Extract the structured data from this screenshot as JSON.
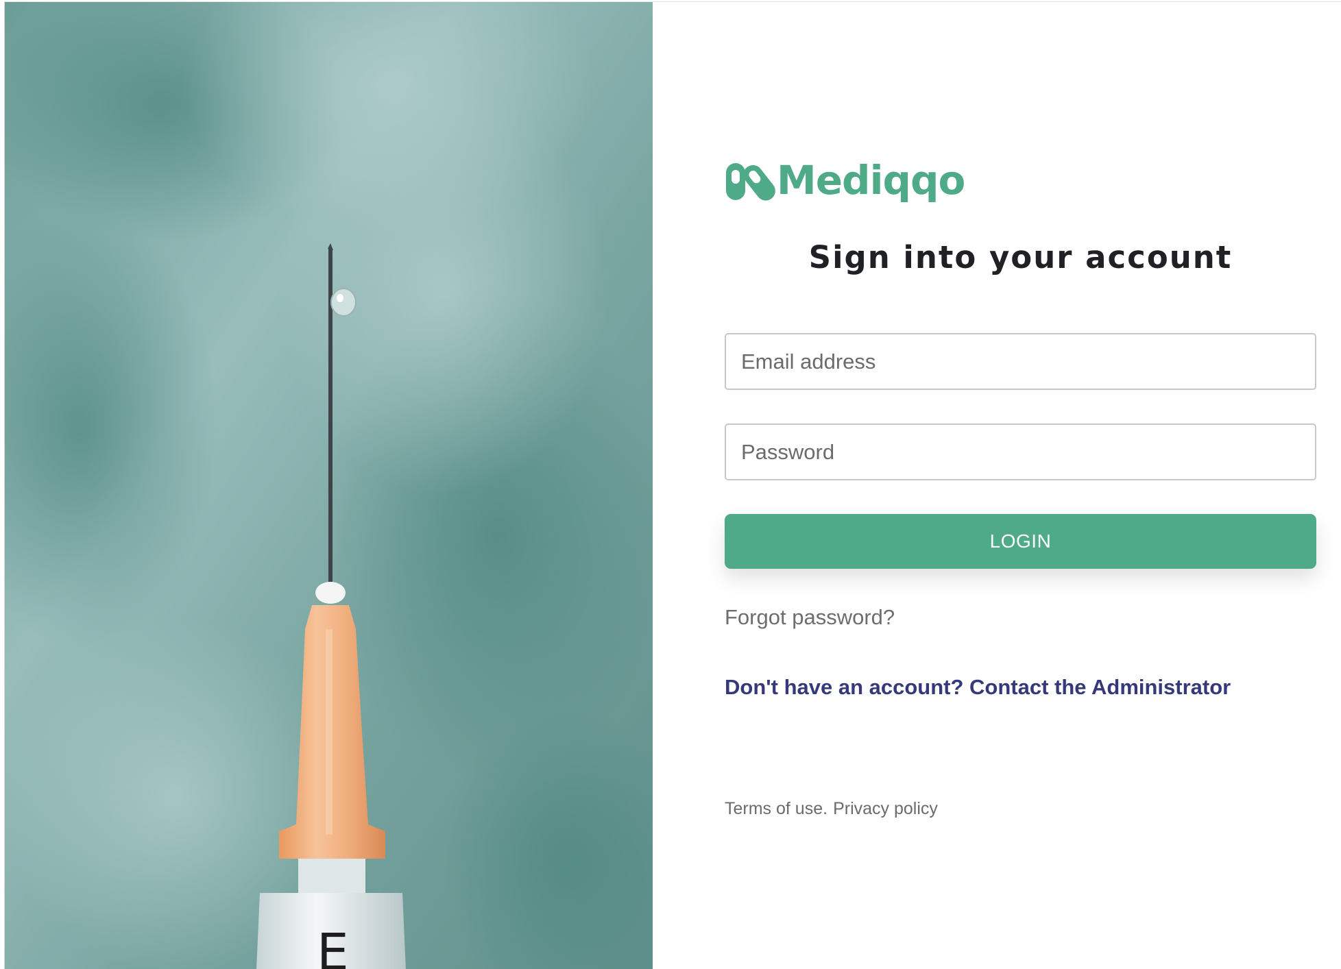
{
  "brand": {
    "name": "Mediqqo",
    "color": "#4faa87"
  },
  "hero": {
    "subject": "syringe-needle-photo",
    "background_color": "#7fa9a6",
    "syringe_marking": "E"
  },
  "form": {
    "title": "Sign into your account",
    "email": {
      "placeholder": "Email address",
      "value": ""
    },
    "password": {
      "placeholder": "Password",
      "value": ""
    },
    "login_label": "LOGIN",
    "forgot_password": "Forgot password?",
    "contact_admin": "Don't have an account? Contact the Administrator",
    "contact_color": "#35397a"
  },
  "footer": {
    "terms": "Terms of use.",
    "privacy": "Privacy policy"
  }
}
